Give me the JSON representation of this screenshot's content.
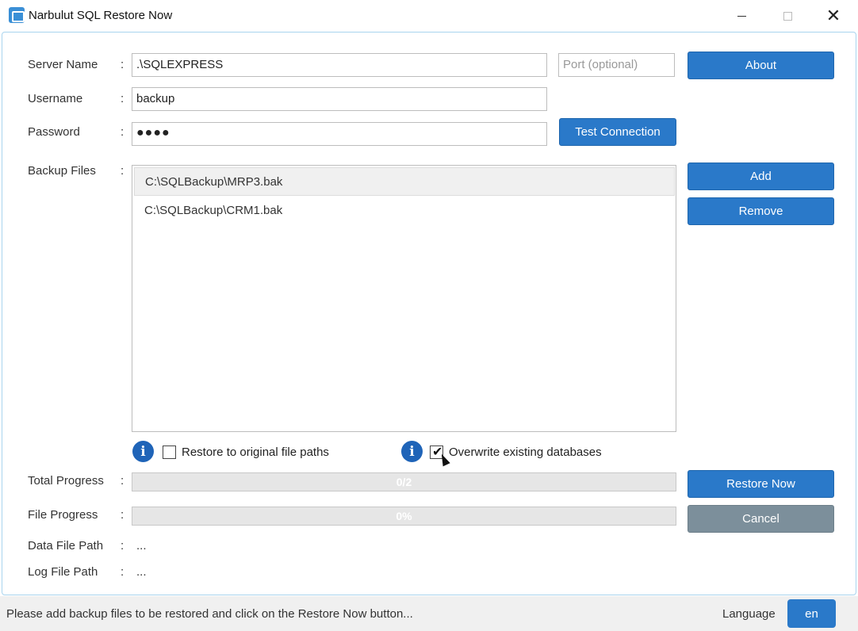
{
  "window": {
    "title": "Narbulut SQL Restore Now",
    "minimize_icon": "minimize-icon",
    "maximize_icon": "maximize-icon",
    "close_icon": "close-icon",
    "close_glyph": "✕"
  },
  "form": {
    "server_name_label": "Server Name",
    "server_name_value": ".\\SQLEXPRESS",
    "port_placeholder": "Port (optional)",
    "username_label": "Username",
    "username_value": "backup",
    "password_label": "Password",
    "password_mask": "●●●●",
    "colon": ":"
  },
  "buttons": {
    "about": "About",
    "test_connection": "Test Connection",
    "add": "Add",
    "remove": "Remove",
    "restore_now": "Restore Now",
    "cancel": "Cancel"
  },
  "backup_files": {
    "label": "Backup Files",
    "items": [
      {
        "path": "C:\\SQLBackup\\MRP3.bak",
        "selected": true
      },
      {
        "path": "C:\\SQLBackup\\CRM1.bak",
        "selected": false
      }
    ]
  },
  "options": {
    "info_glyph": "i",
    "restore_original_paths": {
      "label": "Restore to original file paths",
      "checked": false
    },
    "overwrite_existing": {
      "label": "Overwrite existing databases",
      "checked": true
    },
    "checkmark": "✔"
  },
  "progress": {
    "total_label": "Total Progress",
    "total_text": "0/2",
    "total_fraction": 0,
    "file_label": "File Progress",
    "file_text": "0%",
    "file_fraction": 0
  },
  "paths": {
    "data_file_label": "Data File Path",
    "data_file_value": "...",
    "log_file_label": "Log File Path",
    "log_file_value": "..."
  },
  "status": {
    "message": "Please add backup files to be restored and click on the Restore Now button...",
    "language_label": "Language",
    "language_value": "en"
  },
  "colors": {
    "accent": "#2a79c9",
    "cancel": "#7c8f9b",
    "info": "#1f64b8"
  }
}
